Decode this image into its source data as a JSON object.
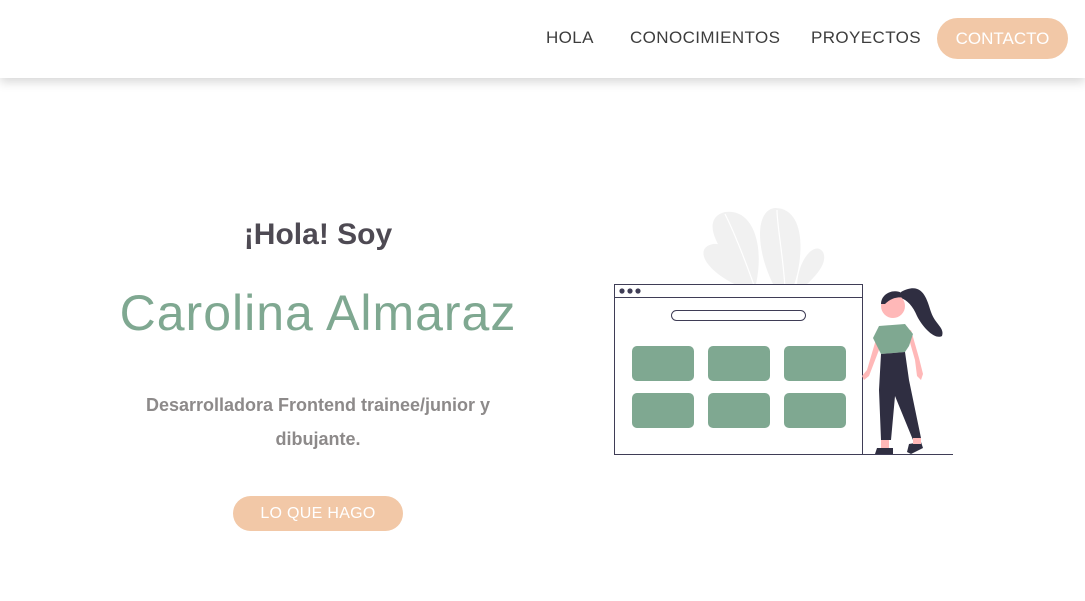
{
  "colors": {
    "accent": "#f2c8a7",
    "primary_green": "#7fa891",
    "heading_text": "#4e4a53",
    "body_text": "#8d8a8a",
    "nav_text": "#3d3d3d"
  },
  "nav": {
    "links": [
      "HOLA",
      "CONOCIMIENTOS",
      "PROYECTOS"
    ],
    "contact_label": "CONTACTO"
  },
  "hero": {
    "greeting": "¡Hola! Soy",
    "name": "Carolina Almaraz",
    "description": "Desarrolladora Frontend trainee/junior y dibujante.",
    "cta_label": "LO QUE HAGO"
  },
  "illustration": {
    "icons": [
      "plant-leaves-icon",
      "browser-window-icon",
      "woman-figure-icon"
    ]
  }
}
